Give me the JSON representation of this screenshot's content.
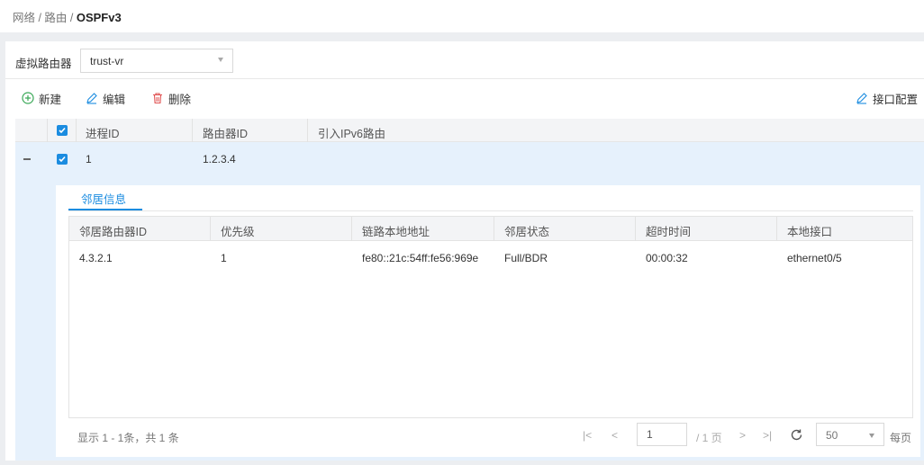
{
  "breadcrumb": {
    "path": "网络 / 路由 / ",
    "current": "OSPFv3"
  },
  "vr": {
    "label": "虚拟路由器",
    "value": "trust-vr"
  },
  "toolbar": {
    "new": "新建",
    "edit": "编辑",
    "delete": "删除",
    "interface": "接口配置"
  },
  "table": {
    "headers": [
      "进程ID",
      "路由器ID",
      "引入IPv6路由"
    ],
    "rows": [
      {
        "process_id": "1",
        "router_id": "1.2.3.4",
        "ipv6": ""
      }
    ]
  },
  "detail": {
    "tab": "邻居信息",
    "headers": [
      "邻居路由器ID",
      "优先级",
      "链路本地地址",
      "邻居状态",
      "超时时间",
      "本地接口"
    ],
    "rows": [
      {
        "router_id": "4.3.2.1",
        "priority": "1",
        "link_local": "fe80::21c:54ff:fe56:969e",
        "state": "Full/BDR",
        "timeout": "00:00:32",
        "interface": "ethernet0/5"
      }
    ]
  },
  "pager": {
    "summary": "显示 1 - 1条，共 1 条",
    "first": "|<",
    "prev": "<",
    "page": "1",
    "total": "/ 1 页",
    "next": ">",
    "last": ">|",
    "page_size": "50",
    "per_page": "每页"
  },
  "colors": {
    "accent": "#1b8ce0",
    "delete": "#e05252",
    "new": "#3aa857",
    "selected_row": "#e6f1fc"
  }
}
